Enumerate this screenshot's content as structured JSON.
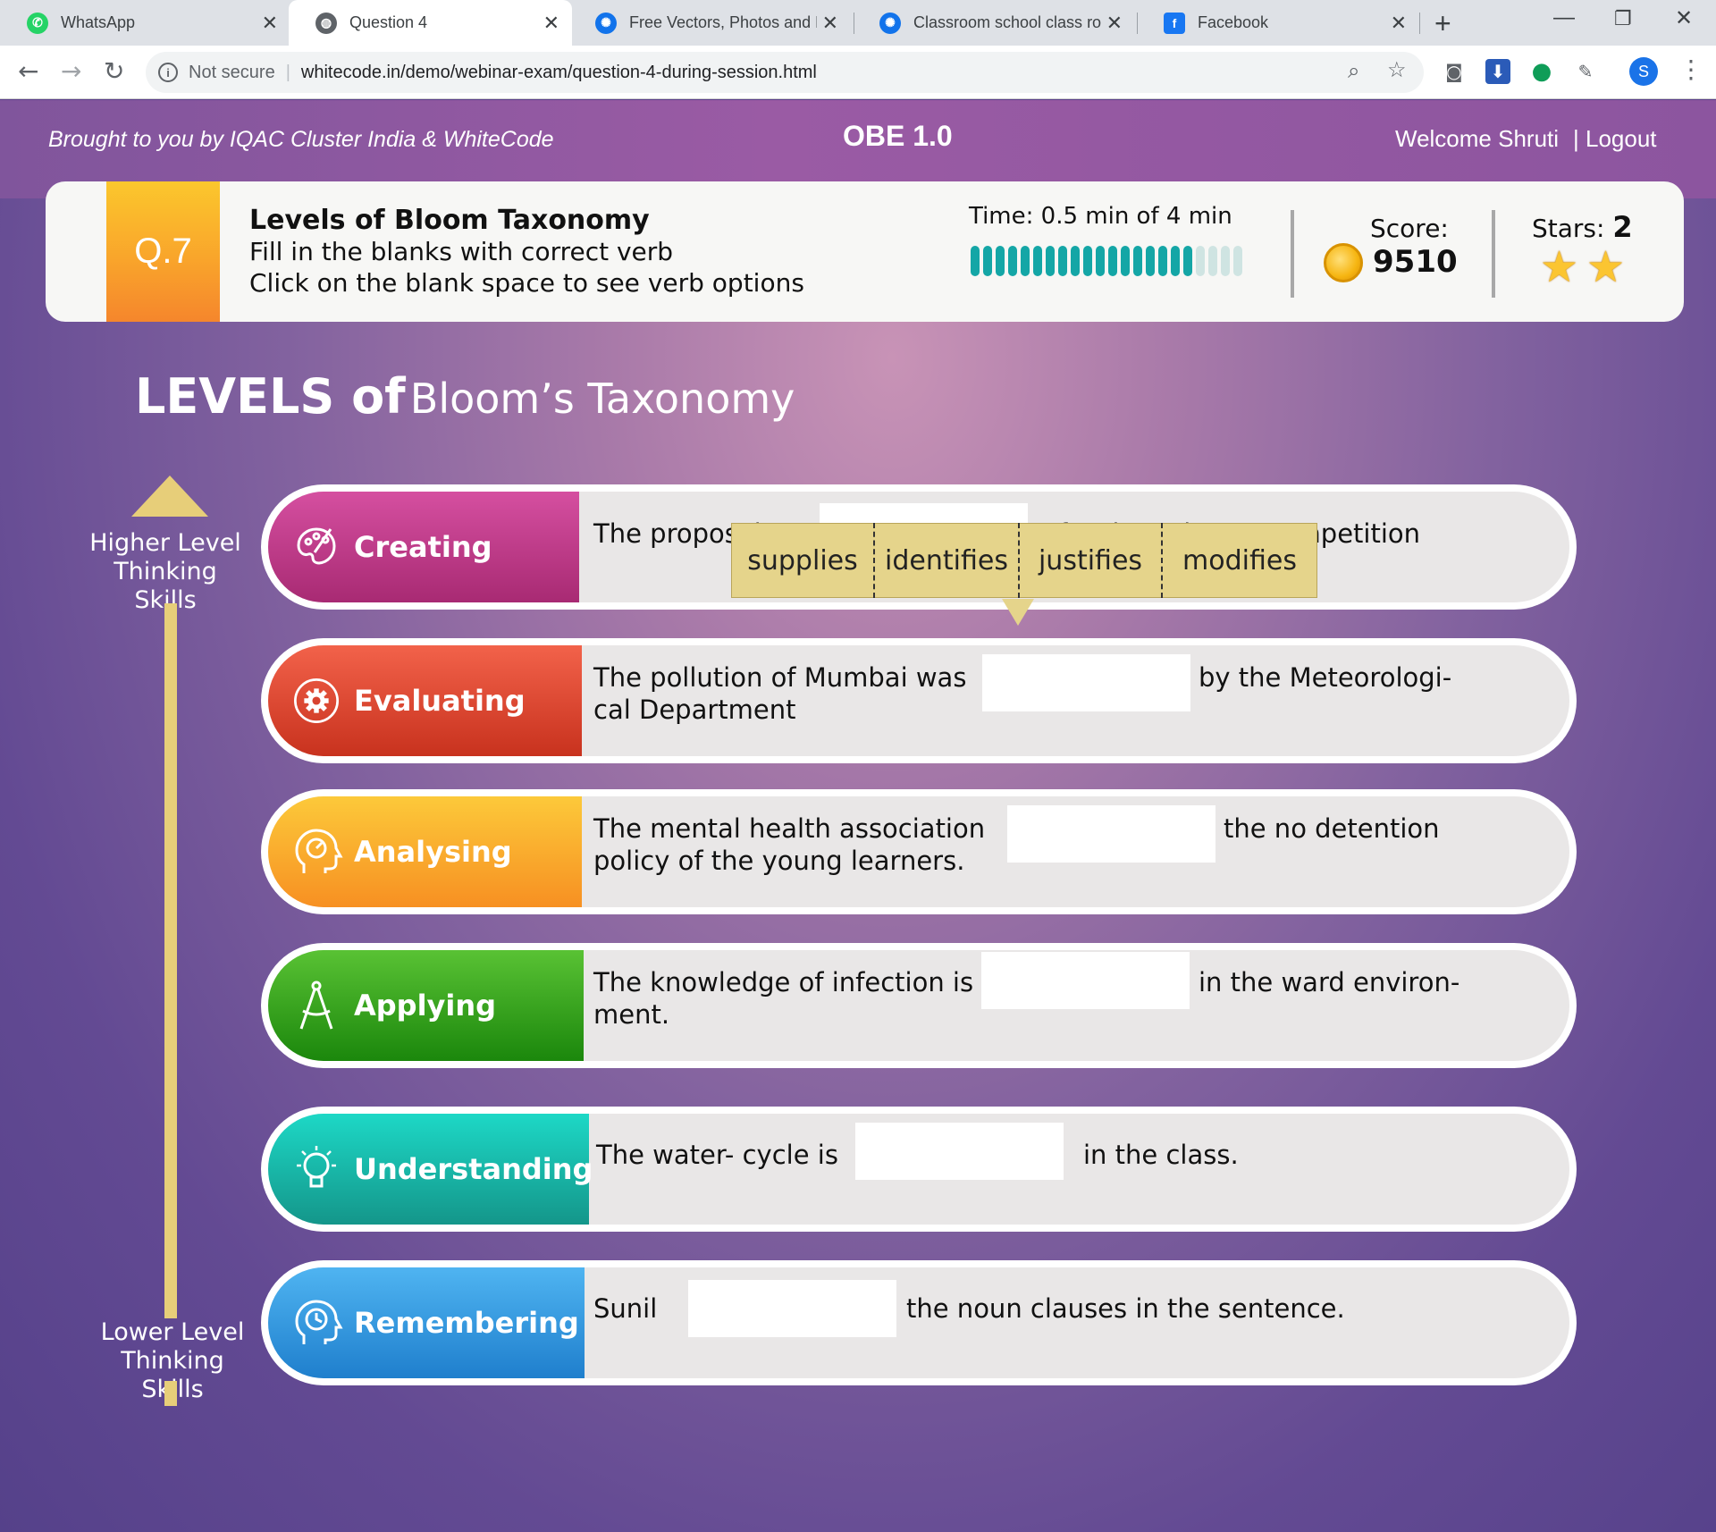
{
  "browser": {
    "tabs": [
      {
        "label": "WhatsApp",
        "icon": "whatsapp-icon",
        "color": "#25d366"
      },
      {
        "label": "Question 4",
        "icon": "globe-icon",
        "color": "#5f6368"
      },
      {
        "label": "Free Vectors, Photos and PS",
        "icon": "freepik-icon",
        "color": "#1273eb"
      },
      {
        "label": "Classroom school class roo",
        "icon": "freepik-icon",
        "color": "#1273eb"
      },
      {
        "label": "Facebook",
        "icon": "facebook-icon",
        "color": "#1877f2"
      }
    ],
    "security_label": "Not secure",
    "url": "whitecode.in/demo/webinar-exam/question-4-during-session.html",
    "profile_initial": "S"
  },
  "header": {
    "credit": "Brought to you by IQAC Cluster India  & WhiteCode",
    "title": "OBE 1.0",
    "welcome": "Welcome Shruti",
    "logout": "| Logout"
  },
  "question": {
    "number": "Q.7",
    "title": "Levels of Bloom Taxonomy",
    "line1": "Fill in the blanks with correct verb",
    "line2": "Click on the blank space to see verb options",
    "time_label": "Time:  0.5 min of 4 min",
    "time_progress": 0.84,
    "score_label": "Score:",
    "score_value": "9510",
    "stars_label": "Stars: ",
    "stars_value": "2",
    "stars_count": 2
  },
  "heading": {
    "big": "LEVELS of",
    "small": "Bloom’s Taxonomy"
  },
  "scale": {
    "higher": "Higher Level\nThinking Skills",
    "lower": "Lower Level\nThinking Skills"
  },
  "verb_options": [
    "supplies",
    "identifies",
    "justifies",
    "modifies"
  ],
  "levels": [
    {
      "name": "Creating",
      "icon": "palette-icon",
      "color_top": "#d54fa0",
      "color_bottom": "#a82a73",
      "before": "The proposal was",
      "after": "for the Science Competition"
    },
    {
      "name": "Evaluating",
      "icon": "gear-cycle-icon",
      "color_top": "#f2624a",
      "color_bottom": "#c8321e",
      "before": "The pollution of Mumbai was",
      "after": "by the Meteorologi-",
      "after2": "cal Department"
    },
    {
      "name": "Analysing",
      "icon": "head-gauge-icon",
      "color_top": "#fcc93a",
      "color_bottom": "#f79022",
      "before": "The mental health association",
      "after": "the no detention",
      "after2": "policy of the young learners."
    },
    {
      "name": "Applying",
      "icon": "compass-icon",
      "color_top": "#59c234",
      "color_bottom": "#1b870c",
      "before": "The knowledge of infection is",
      "after": "in the ward environ-",
      "after2": "ment."
    },
    {
      "name": "Understanding",
      "icon": "lightbulb-icon",
      "color_top": "#1dd8c6",
      "color_bottom": "#14968a",
      "before": "The water- cycle is",
      "after": "in the class."
    },
    {
      "name": "Remembering",
      "icon": "head-clock-icon",
      "color_top": "#4fb4f1",
      "color_bottom": "#1f7fcd",
      "before": "Sunil",
      "after": "the noun clauses in the sentence."
    }
  ]
}
